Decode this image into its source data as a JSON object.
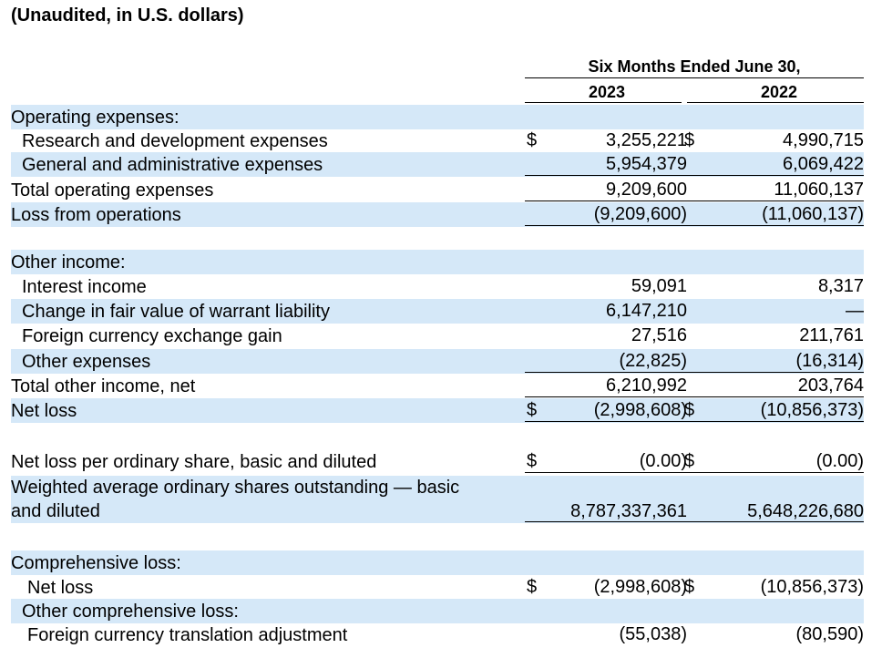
{
  "document": {
    "subtitle": "(Unaudited, in U.S. dollars)",
    "period_header": "Six Months Ended June 30,",
    "year_2023": "2023",
    "year_2022": "2022"
  },
  "rows": [
    {
      "label": "Operating expenses:",
      "indent": 0,
      "shaded": true,
      "c1": "",
      "v1": "",
      "c2": "",
      "v2": ""
    },
    {
      "label": "Research and development expenses",
      "indent": 1,
      "shaded": false,
      "c1": "$",
      "v1": "3,255,221",
      "c2": "$",
      "v2": "4,990,715"
    },
    {
      "label": "General and administrative expenses",
      "indent": 1,
      "shaded": true,
      "c1": "",
      "v1": "5,954,379",
      "c2": "",
      "v2": "6,069,422"
    },
    {
      "label": "Total operating expenses",
      "indent": 0,
      "shaded": false,
      "c1": "",
      "v1": "9,209,600",
      "c2": "",
      "v2": "11,060,137"
    },
    {
      "label": "Loss from operations",
      "indent": 0,
      "shaded": true,
      "c1": "",
      "v1": "(9,209,600)",
      "c2": "",
      "v2": "(11,060,137)"
    },
    {
      "label": "Other income:",
      "indent": 0,
      "shaded": true,
      "c1": "",
      "v1": "",
      "c2": "",
      "v2": ""
    },
    {
      "label": "Interest income",
      "indent": 1,
      "shaded": false,
      "c1": "",
      "v1": "59,091",
      "c2": "",
      "v2": "8,317"
    },
    {
      "label": "Change in fair value of warrant liability",
      "indent": 1,
      "shaded": true,
      "c1": "",
      "v1": "6,147,210",
      "c2": "",
      "v2": "—"
    },
    {
      "label": "Foreign currency exchange gain",
      "indent": 1,
      "shaded": false,
      "c1": "",
      "v1": "27,516",
      "c2": "",
      "v2": "211,761"
    },
    {
      "label": "Other expenses",
      "indent": 1,
      "shaded": true,
      "c1": "",
      "v1": "(22,825)",
      "c2": "",
      "v2": "(16,314)"
    },
    {
      "label": "Total other income, net",
      "indent": 0,
      "shaded": false,
      "c1": "",
      "v1": "6,210,992",
      "c2": "",
      "v2": "203,764"
    },
    {
      "label": "Net loss",
      "indent": 0,
      "shaded": true,
      "c1": "$",
      "v1": "(2,998,608)",
      "c2": "$",
      "v2": "(10,856,373)"
    },
    {
      "label": "Net loss per ordinary share, basic and diluted",
      "indent": 0,
      "shaded": false,
      "c1": "$",
      "v1": "(0.00)",
      "c2": "$",
      "v2": "(0.00)"
    },
    {
      "label": "Weighted average ordinary shares outstanding — basic",
      "label2": "and diluted",
      "indent": 0,
      "shaded": true,
      "c1": "",
      "v1": "8,787,337,361",
      "c2": "",
      "v2": "5,648,226,680"
    },
    {
      "label": "Comprehensive loss:",
      "indent": 0,
      "shaded": true,
      "c1": "",
      "v1": "",
      "c2": "",
      "v2": ""
    },
    {
      "label": "Net loss",
      "indent": 2,
      "shaded": false,
      "c1": "$",
      "v1": "(2,998,608)",
      "c2": "$",
      "v2": "(10,856,373)"
    },
    {
      "label": "Other comprehensive loss:",
      "indent": 1,
      "shaded": true,
      "c1": "",
      "v1": "",
      "c2": "",
      "v2": ""
    },
    {
      "label": "Foreign currency translation adjustment",
      "indent": 2,
      "shaded": false,
      "c1": "",
      "v1": "(55,038)",
      "c2": "",
      "v2": "(80,590)"
    }
  ]
}
